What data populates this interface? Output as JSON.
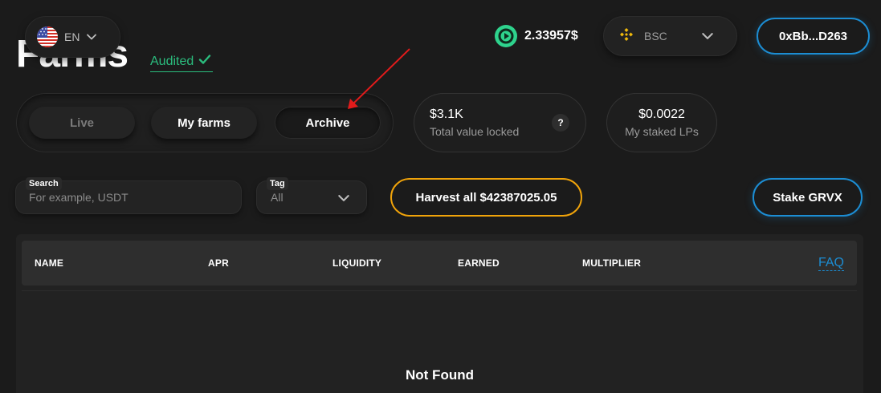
{
  "header": {
    "title": "Farms",
    "audited_label": "Audited",
    "language": {
      "code": "EN",
      "flag_icon": "us-flag-icon"
    },
    "price": {
      "value": "2.33957$",
      "token_icon": "grvx-token-icon",
      "token_color": "#2ed38d"
    },
    "network": {
      "name": "BSC",
      "icon": "bnb-icon",
      "icon_color": "#f0b90b"
    },
    "wallet_label": "0xBb...D263"
  },
  "tabs": [
    {
      "label": "Live"
    },
    {
      "label": "My farms"
    },
    {
      "label": "Archive",
      "selected": true
    }
  ],
  "stats": {
    "tvl": {
      "value": "$3.1K",
      "label": "Total value locked",
      "help": "?"
    },
    "staked": {
      "value": "$0.0022",
      "label": "My staked LPs"
    }
  },
  "filters": {
    "search": {
      "label": "Search",
      "placeholder": "For example, USDT",
      "value": ""
    },
    "tag": {
      "label": "Tag",
      "value": "All"
    }
  },
  "actions": {
    "harvest_label": "Harvest all $42387025.05",
    "stake_label": "Stake GRVX"
  },
  "table": {
    "columns": [
      "NAME",
      "APR",
      "LIQUIDITY",
      "EARNED",
      "MULTIPLIER"
    ],
    "faq_label": "FAQ",
    "empty_text": "Not Found"
  },
  "colors": {
    "background": "#1b1b1b",
    "accent_blue": "#1c8dd3",
    "accent_orange": "#f0a30a",
    "audited_green": "#2bbd7e",
    "annotation_red": "#e21b1b"
  }
}
